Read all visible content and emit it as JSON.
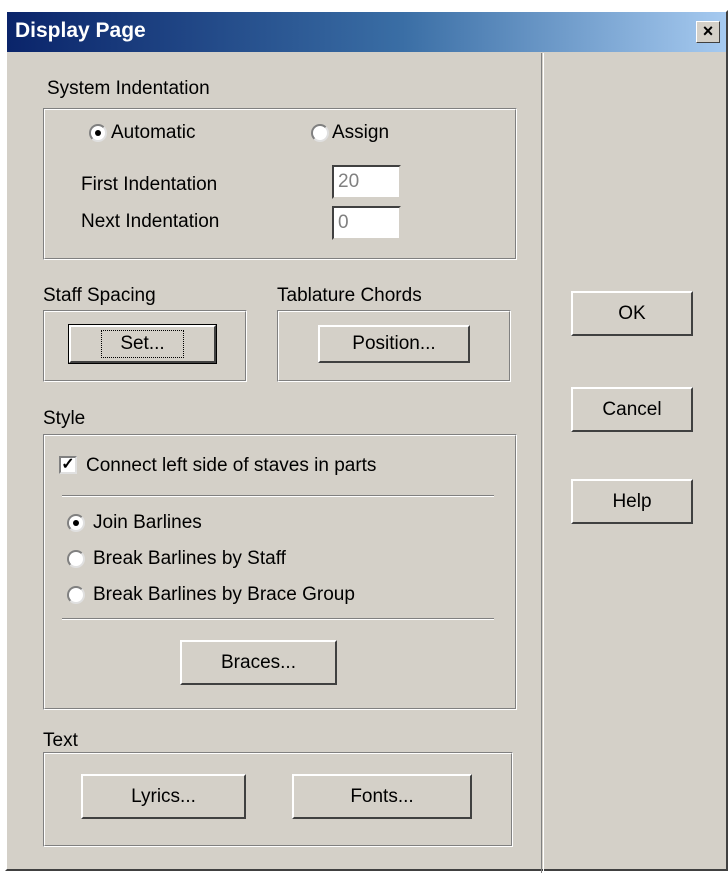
{
  "window": {
    "title": "Display Page",
    "close_glyph": "×"
  },
  "system_indentation": {
    "label": "System Indentation",
    "automatic_label": "Automatic",
    "assign_label": "Assign",
    "first_label": "First Indentation",
    "first_value": "20",
    "next_label": "Next Indentation",
    "next_value": "0"
  },
  "staff_spacing": {
    "label": "Staff Spacing",
    "set_label": "Set..."
  },
  "tablature_chords": {
    "label": "Tablature Chords",
    "position_label": "Position..."
  },
  "style": {
    "label": "Style",
    "connect_label": "Connect left side of staves in parts",
    "join_label": "Join Barlines",
    "break_staff_label": "Break Barlines by Staff",
    "break_brace_label": "Break Barlines by Brace Group",
    "braces_label": "Braces..."
  },
  "text": {
    "label": "Text",
    "lyrics_label": "Lyrics...",
    "fonts_label": "Fonts..."
  },
  "buttons": {
    "ok": "OK",
    "cancel": "Cancel",
    "help": "Help"
  }
}
